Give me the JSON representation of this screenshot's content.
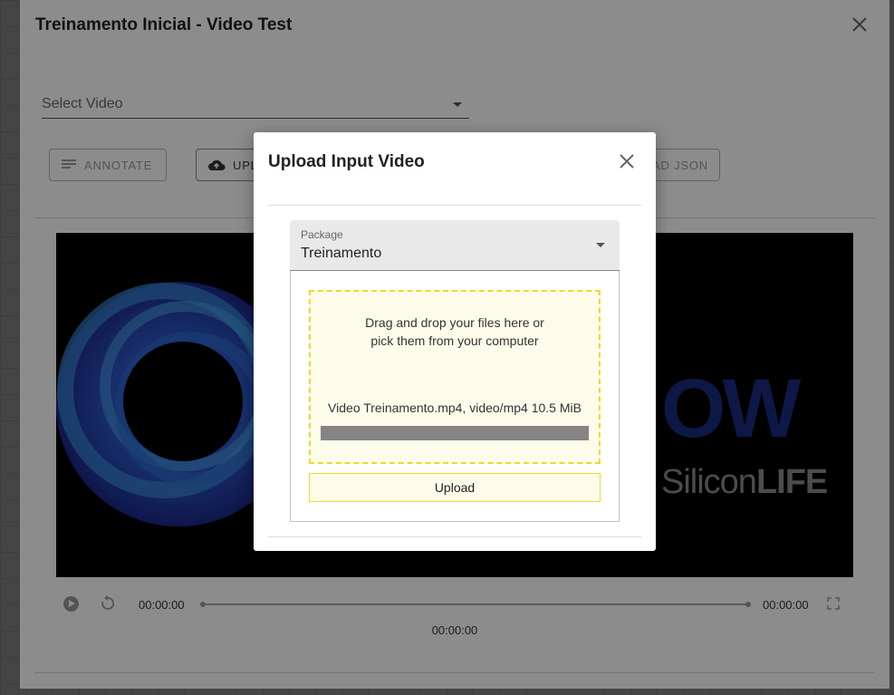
{
  "outer": {
    "title": "Treinamento Inicial - Video Test",
    "select_video_label": "Select Video",
    "buttons": {
      "annotate": "ANNOTATE",
      "upload": "UPL",
      "json": "AD JSON"
    },
    "player": {
      "time_current": "00:00:00",
      "time_total": "00:00:00",
      "time_center": "00:00:00",
      "video_logo_text": "OW",
      "video_logo_sub": "Silicon",
      "video_logo_sub_bold": "LIFE"
    }
  },
  "modal": {
    "title": "Upload Input Video",
    "package": {
      "label": "Package",
      "value": "Treinamento"
    },
    "dropzone": {
      "text": "Drag and drop your files here or pick them from your computer",
      "file_info": "Video Treinamento.mp4, video/mp4  10.5 MiB",
      "progress": 1.0
    },
    "upload_button": "Upload"
  },
  "colors": {
    "dropzone_border": "#f0d925",
    "dropzone_bg": "#fdfceb",
    "logo_blue": "#1b2c80"
  },
  "icons": {
    "close": "close-icon",
    "annotate": "notes-icon",
    "upload": "cloud-upload-icon",
    "dropdown": "caret-down-icon",
    "play": "play-icon",
    "replay": "replay-icon",
    "fullscreen": "fullscreen-icon"
  }
}
